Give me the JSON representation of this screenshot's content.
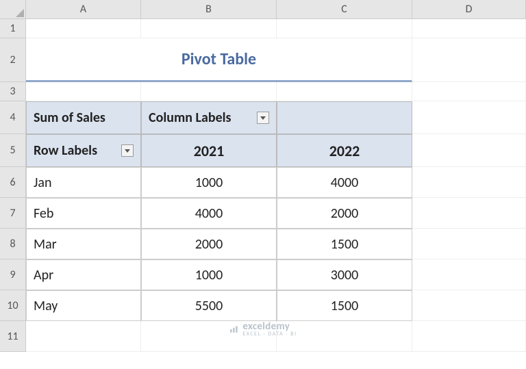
{
  "columns": [
    "A",
    "B",
    "C",
    "D"
  ],
  "rows": [
    "1",
    "2",
    "3",
    "4",
    "5",
    "6",
    "7",
    "8",
    "9",
    "10",
    "11"
  ],
  "title": "Pivot Table",
  "pivot": {
    "ul_label": "Sum of Sales",
    "col_labels_text": "Column Labels",
    "row_labels_text": "Row Labels",
    "col_headers": [
      "2021",
      "2022"
    ],
    "rows": [
      "Jan",
      "Feb",
      "Mar",
      "Apr",
      "May"
    ],
    "data": [
      [
        1000,
        4000
      ],
      [
        4000,
        2000
      ],
      [
        2000,
        1500
      ],
      [
        1000,
        3000
      ],
      [
        5500,
        1500
      ]
    ]
  },
  "watermark": {
    "brand": "exceldemy",
    "tag": "EXCEL · DATA · BI"
  },
  "chart_data": {
    "type": "table",
    "title": "Pivot Table — Sum of Sales",
    "categories": [
      "Jan",
      "Feb",
      "Mar",
      "Apr",
      "May"
    ],
    "series": [
      {
        "name": "2021",
        "values": [
          1000,
          4000,
          2000,
          1000,
          5500
        ]
      },
      {
        "name": "2022",
        "values": [
          4000,
          2000,
          1500,
          3000,
          1500
        ]
      }
    ]
  }
}
